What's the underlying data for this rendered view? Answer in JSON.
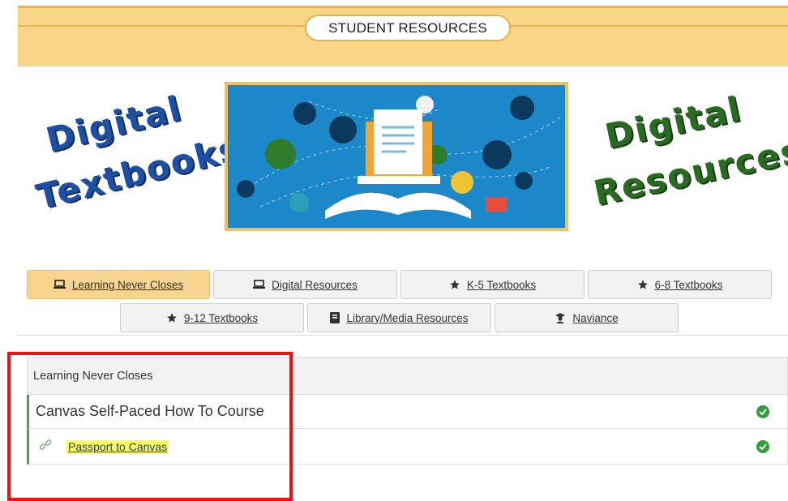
{
  "header": {
    "title": "STUDENT RESOURCES"
  },
  "banner_left": {
    "line1": "Digital",
    "line2": "Textbooks"
  },
  "banner_right": {
    "line1": "Digital",
    "line2": "Resources"
  },
  "tabs": [
    {
      "label": "Learning Never Closes",
      "icon": "laptop-icon",
      "active": true
    },
    {
      "label": "Digital Resources",
      "icon": "laptop-icon",
      "active": false
    },
    {
      "label": "K-5 Textbooks",
      "icon": "star-icon",
      "active": false
    },
    {
      "label": "6-8 Textbooks",
      "icon": "star-icon",
      "active": false
    },
    {
      "label": "9-12 Textbooks",
      "icon": "star-icon",
      "active": false
    },
    {
      "label": "Library/Media Resources",
      "icon": "book-icon",
      "active": false
    },
    {
      "label": "Naviance",
      "icon": "graduate-icon",
      "active": false
    }
  ],
  "section": {
    "title": "Learning Never Closes",
    "items": [
      {
        "label": "Canvas Self-Paced How To Course",
        "status": "check-icon"
      },
      {
        "label": "Passport to Canvas",
        "icon": "link-icon",
        "status": "check-icon"
      }
    ]
  },
  "colors": {
    "accent": "#f8d58e",
    "highlight": "#ffff55",
    "check": "#2f9e3c",
    "annotation": "#ee1111"
  }
}
